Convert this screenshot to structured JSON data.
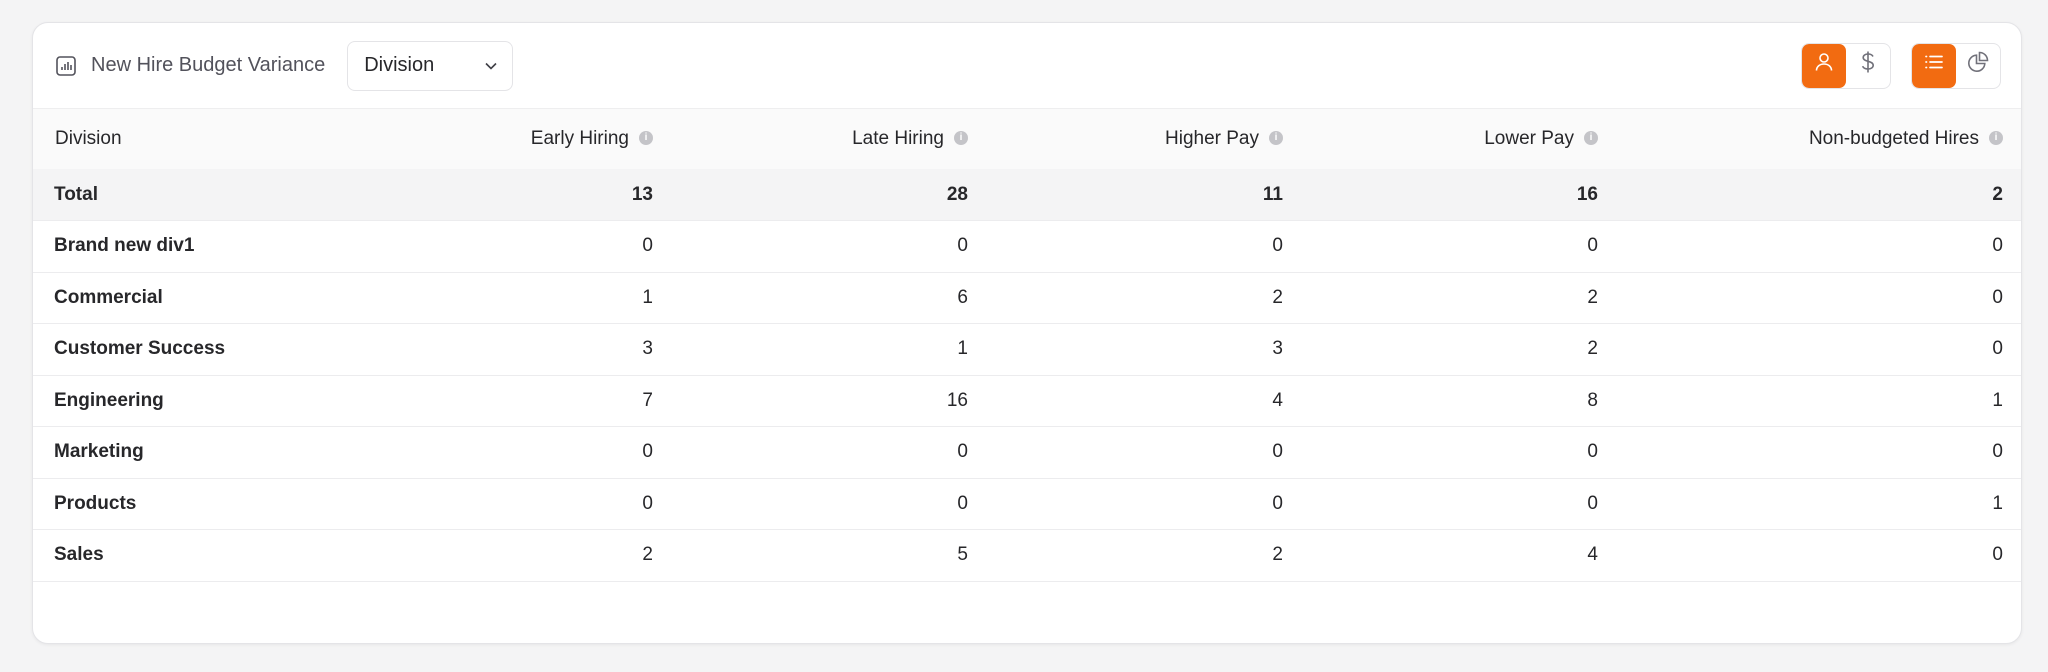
{
  "widget": {
    "title": "New Hire Budget Variance",
    "title_icon": "bar-chart-icon",
    "group_by_select": {
      "selected": "Division"
    },
    "metric_toggle": [
      {
        "icon": "person-icon",
        "active": true
      },
      {
        "icon": "dollar-icon",
        "active": false
      }
    ],
    "view_toggle": [
      {
        "icon": "list-icon",
        "active": true
      },
      {
        "icon": "pie-chart-icon",
        "active": false
      }
    ],
    "accent_color": "#f26b11"
  },
  "table": {
    "columns": [
      "Division",
      "Early Hiring",
      "Late Hiring",
      "Higher Pay",
      "Lower Pay",
      "Non-budgeted Hires"
    ],
    "total": {
      "label": "Total",
      "values": [
        "13",
        "28",
        "11",
        "16",
        "2"
      ]
    },
    "rows": [
      {
        "label": "Brand new div1",
        "values": [
          "0",
          "0",
          "0",
          "0",
          "0"
        ]
      },
      {
        "label": "Commercial",
        "values": [
          "1",
          "6",
          "2",
          "2",
          "0"
        ]
      },
      {
        "label": "Customer Success",
        "values": [
          "3",
          "1",
          "3",
          "2",
          "0"
        ]
      },
      {
        "label": "Engineering",
        "values": [
          "7",
          "16",
          "4",
          "8",
          "1"
        ]
      },
      {
        "label": "Marketing",
        "values": [
          "0",
          "0",
          "0",
          "0",
          "0"
        ]
      },
      {
        "label": "Products",
        "values": [
          "0",
          "0",
          "0",
          "0",
          "1"
        ]
      },
      {
        "label": "Sales",
        "values": [
          "2",
          "5",
          "2",
          "4",
          "0"
        ]
      }
    ]
  }
}
